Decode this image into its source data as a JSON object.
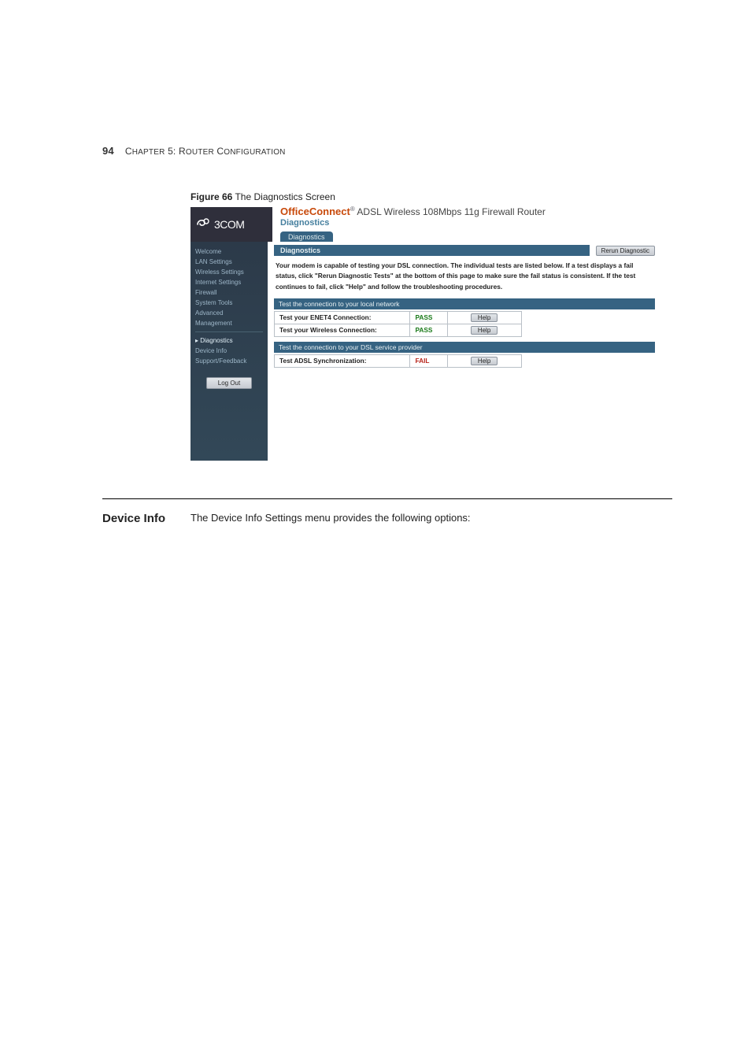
{
  "page": {
    "number": "94",
    "chapter_prefix": "C",
    "chapter_rest": "HAPTER",
    "chapter_num": "5: R",
    "chapter_rest2": "OUTER",
    "chapter_word": " C",
    "chapter_rest3": "ONFIGURATION"
  },
  "figure": {
    "label": "Figure 66",
    "caption": "   The Diagnostics Screen"
  },
  "banner": {
    "brand": "3COM",
    "product": "OfficeConnect",
    "product_desc": "ADSL Wireless 108Mbps 11g Firewall Router",
    "page_title": "Diagnostics",
    "tab": "Diagnostics"
  },
  "sidebar": {
    "items": [
      "Welcome",
      "LAN Settings",
      "Wireless Settings",
      "Internet Settings",
      "Firewall",
      "System Tools",
      "Advanced",
      "Management"
    ],
    "items2": [
      "Diagnostics",
      "Device Info",
      "Support/Feedback"
    ],
    "logout": "Log Out"
  },
  "content": {
    "section_title": "Diagnostics",
    "rerun": "Rerun Diagnostic",
    "description": "Your modem is capable of testing your DSL connection. The individual tests are listed below. If a test displays a fail status, click \"Rerun Diagnostic Tests\" at the bottom of this page to make sure the fail status is consistent. If the test continues to fail, click \"Help\" and follow the troubleshooting procedures.",
    "subhead1": "Test the connection to your local network",
    "tests1": [
      {
        "label": "Test your ENET4 Connection:",
        "status": "PASS",
        "pass": true
      },
      {
        "label": "Test your Wireless Connection:",
        "status": "PASS",
        "pass": true
      }
    ],
    "subhead2": "Test the connection to your DSL service provider",
    "tests2": [
      {
        "label": "Test ADSL Synchronization:",
        "status": "FAIL",
        "pass": false
      }
    ],
    "help": "Help"
  },
  "device_info": {
    "title": "Device Info",
    "text": "The Device Info Settings menu provides the following options:"
  }
}
